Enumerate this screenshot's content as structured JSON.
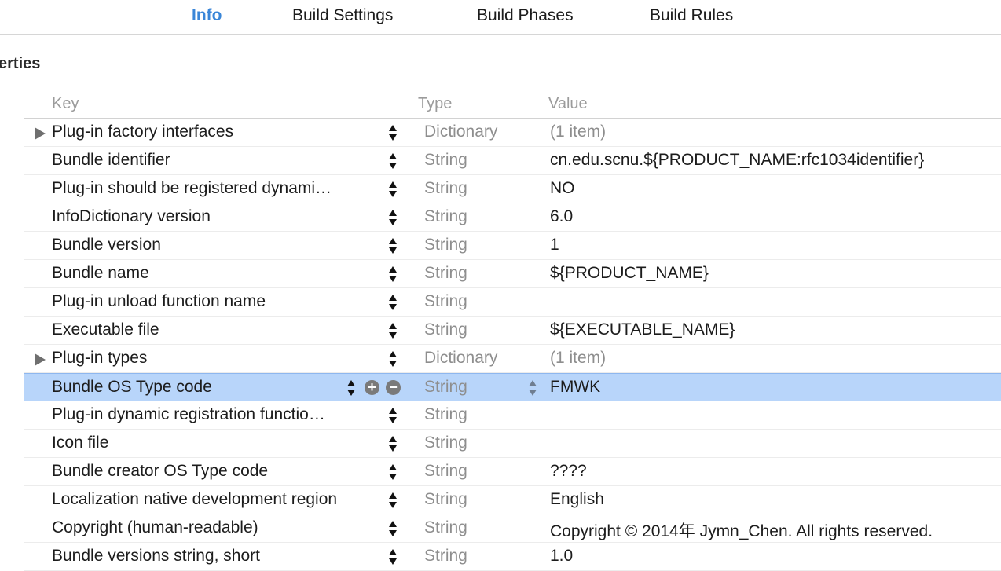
{
  "tabs": [
    {
      "label": "Info",
      "active": true
    },
    {
      "label": "Build Settings",
      "active": false
    },
    {
      "label": "Build Phases",
      "active": false
    },
    {
      "label": "Build Rules",
      "active": false
    }
  ],
  "section_title": "erties",
  "columns": {
    "key": "Key",
    "type": "Type",
    "value": "Value"
  },
  "rows": [
    {
      "key": "Plug-in factory interfaces",
      "type": "Dictionary",
      "value": "(1 item)",
      "expandable": true,
      "muted_value": true
    },
    {
      "key": "Bundle identifier",
      "type": "String",
      "value": "cn.edu.scnu.${PRODUCT_NAME:rfc1034identifier}"
    },
    {
      "key": "Plug-in should be registered dynami…",
      "type": "String",
      "value": "NO"
    },
    {
      "key": "InfoDictionary version",
      "type": "String",
      "value": "6.0"
    },
    {
      "key": "Bundle version",
      "type": "String",
      "value": "1"
    },
    {
      "key": "Bundle name",
      "type": "String",
      "value": "${PRODUCT_NAME}"
    },
    {
      "key": "Plug-in unload function name",
      "type": "String",
      "value": ""
    },
    {
      "key": "Executable file",
      "type": "String",
      "value": "${EXECUTABLE_NAME}"
    },
    {
      "key": "Plug-in types",
      "type": "Dictionary",
      "value": "(1 item)",
      "expandable": true,
      "muted_value": true
    },
    {
      "key": "Bundle OS Type code",
      "type": "String",
      "value": "FMWK",
      "selected": true
    },
    {
      "key": "Plug-in dynamic registration functio…",
      "type": "String",
      "value": ""
    },
    {
      "key": "Icon file",
      "type": "String",
      "value": ""
    },
    {
      "key": "Bundle creator OS Type code",
      "type": "String",
      "value": "????"
    },
    {
      "key": "Localization native development region",
      "type": "String",
      "value": "English"
    },
    {
      "key": "Copyright (human-readable)",
      "type": "String",
      "value": "Copyright © 2014年 Jymn_Chen. All rights reserved."
    },
    {
      "key": "Bundle versions string, short",
      "type": "String",
      "value": "1.0"
    }
  ],
  "icons": {
    "add": "+",
    "remove": "−"
  },
  "colors": {
    "accent": "#3a86d8",
    "selection": "#b8d5fa"
  }
}
